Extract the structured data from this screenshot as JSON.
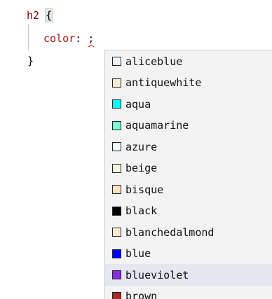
{
  "editor": {
    "line1": {
      "selector": "h2",
      "brace": "{"
    },
    "line2": {
      "property": "color",
      "colon": ": ",
      "value": ";"
    },
    "line3": {
      "brace": "}"
    }
  },
  "suggestions": {
    "items": [
      {
        "label": "aliceblue",
        "color": "#f0f8ff"
      },
      {
        "label": "antiquewhite",
        "color": "#faebd7"
      },
      {
        "label": "aqua",
        "color": "#00ffff"
      },
      {
        "label": "aquamarine",
        "color": "#7fffd4"
      },
      {
        "label": "azure",
        "color": "#f0ffff"
      },
      {
        "label": "beige",
        "color": "#f5f5dc"
      },
      {
        "label": "bisque",
        "color": "#ffe4c4"
      },
      {
        "label": "black",
        "color": "#000000"
      },
      {
        "label": "blanchedalmond",
        "color": "#ffebcd"
      },
      {
        "label": "blue",
        "color": "#0000ff"
      },
      {
        "label": "blueviolet",
        "color": "#8a2be2",
        "selected": true
      },
      {
        "label": "brown",
        "color": "#a52a2a"
      }
    ]
  }
}
